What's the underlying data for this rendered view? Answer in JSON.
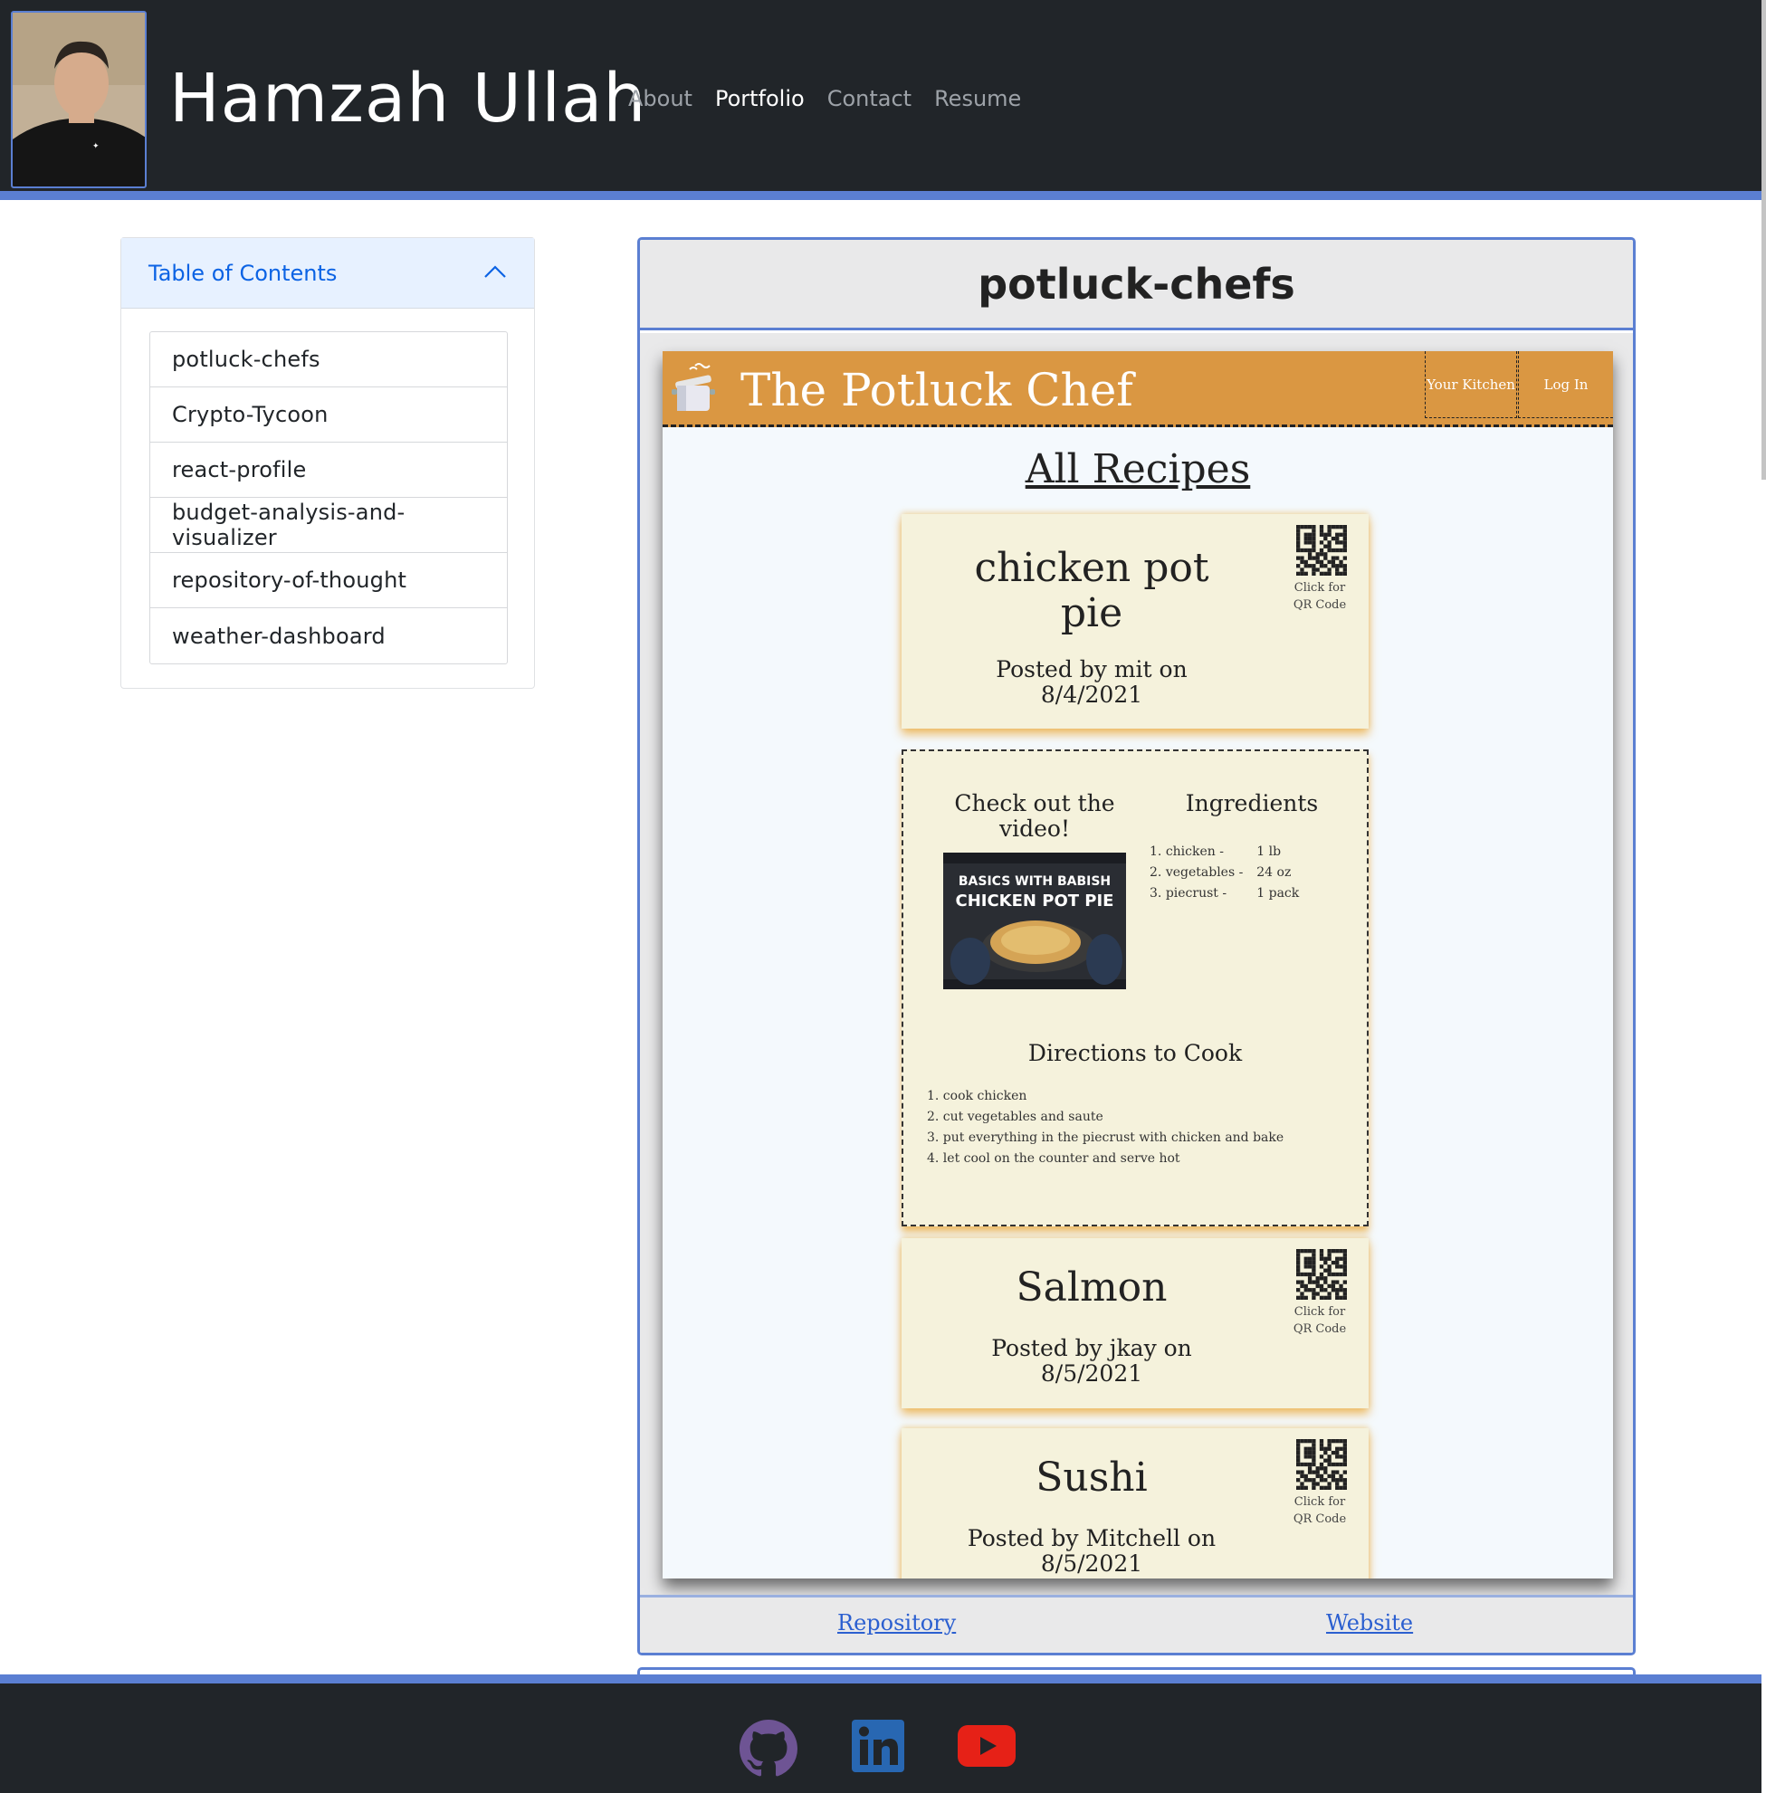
{
  "header": {
    "name": "Hamzah Ullah",
    "nav": [
      "About",
      "Portfolio",
      "Contact",
      "Resume"
    ],
    "active_nav": "Portfolio"
  },
  "toc": {
    "title": "Table of Contents",
    "items": [
      "potluck-chefs",
      "Crypto-Tycoon",
      "react-profile",
      "budget-analysis-and-visualizer",
      "repository-of-thought",
      "weather-dashboard"
    ]
  },
  "project": {
    "name": "potluck-chefs",
    "repository_link": "Repository",
    "website_link": "Website",
    "screenshot": {
      "app_title": "The Potluck Chef",
      "nav_your_kitchen": "Your Kitchen",
      "nav_log_in": "Log In",
      "heading": "All Recipes",
      "qr_label_1": "Click for",
      "qr_label_2": "QR Code",
      "recipes": [
        {
          "name_line1": "chicken pot",
          "name_line2": "pie",
          "meta_line1": "Posted by mit on",
          "meta_line2": "8/4/2021"
        },
        {
          "name_line1": "Salmon",
          "name_line2": "",
          "meta_line1": "Posted by jkay on",
          "meta_line2": "8/5/2021"
        },
        {
          "name_line1": "Sushi",
          "name_line2": "",
          "meta_line1": "Posted by Mitchell on",
          "meta_line2": "8/5/2021"
        }
      ],
      "detail": {
        "video_heading_1": "Check out the",
        "video_heading_2": "video!",
        "video_thumb_line1": "BASICS WITH BABISH",
        "video_thumb_line2": "CHICKEN POT PIE",
        "ingredients_heading": "Ingredients",
        "ingredients": [
          {
            "n": "1.",
            "item": "chicken -",
            "qty": "1 lb"
          },
          {
            "n": "2.",
            "item": "vegetables -",
            "qty": "24 oz"
          },
          {
            "n": "3.",
            "item": "piecrust -",
            "qty": "1 pack"
          }
        ],
        "directions_heading": "Directions to Cook",
        "directions": [
          "1. cook chicken",
          "2. cut vegetables and saute",
          "3. put everything in the piecrust with chicken and bake",
          "4. let cool on the counter and serve hot"
        ]
      }
    }
  },
  "footer": {
    "icons": [
      "github-icon",
      "linkedin-icon",
      "youtube-icon"
    ],
    "colors": {
      "github": "#6e5494",
      "linkedin": "#2867b2",
      "youtube": "#e62117"
    }
  },
  "colors": {
    "header_bg": "#212529",
    "accent": "#5b7fd2",
    "toc_header_bg": "#e7f1ff",
    "toc_title": "#0c63e4",
    "app_bar": "#da9742",
    "recipe_card": "#f5f2dc"
  }
}
